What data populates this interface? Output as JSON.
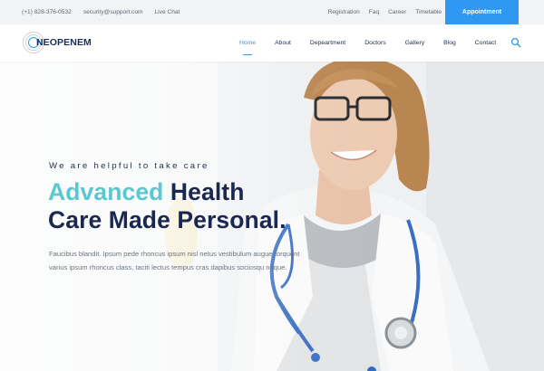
{
  "topbar": {
    "phone": "(+1) 828-376-0532",
    "email": "security@support.com",
    "live_chat": "Live Chat",
    "links": [
      "Registration",
      "Faq",
      "Career",
      "Timetable"
    ],
    "appointment_label": "Appointment"
  },
  "brand": {
    "name": "NEOPENEM",
    "accent_color": "#2e98f2",
    "dark_color": "#1a2750",
    "teal_color": "#5ac8cf"
  },
  "nav": {
    "items": [
      "Home",
      "About",
      "Depeartment",
      "Doctors",
      "Gallery",
      "Blog",
      "Contact"
    ],
    "active": "Home",
    "search_icon": "search-icon"
  },
  "hero": {
    "tagline": "We are helpful to take care",
    "headline_accent": "Advanced",
    "headline_line1_rest": " Health",
    "headline_line2": "Care Made Personal.",
    "description": "Faucibus blandit. Ipsum pede rhoncus ipsum nisl netus vestibulum augue torquent varius ipsum rhoncus class, taciti lectus tempus cras dapibus sociosqu neque."
  }
}
